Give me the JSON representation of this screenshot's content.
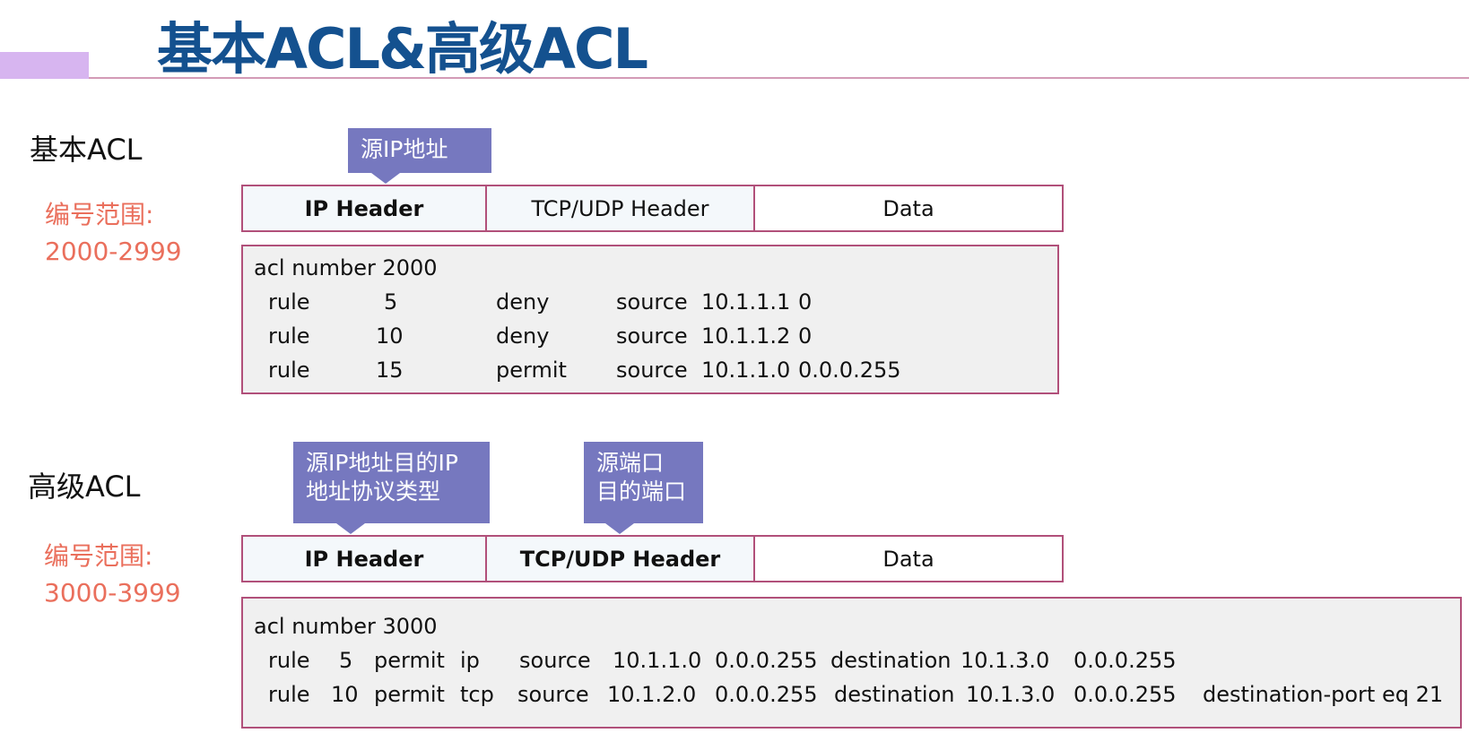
{
  "title": "基本ACL&高级ACL",
  "basic": {
    "section_title": "基本ACL",
    "range_label": "编号范围:",
    "range_value": "2000-2999",
    "callout": "源IP地址",
    "headers": [
      "IP Header",
      "TCP/UDP Header",
      "Data"
    ],
    "config_title": "acl number 2000",
    "rules": [
      [
        "rule",
        "5",
        "deny",
        "source",
        "10.1.1.1",
        "0"
      ],
      [
        "rule",
        "10",
        "deny",
        "source",
        "10.1.1.2",
        "0"
      ],
      [
        "rule",
        "15",
        "permit",
        "source",
        "10.1.1.0",
        "0.0.0.255"
      ]
    ]
  },
  "advanced": {
    "section_title": "高级ACL",
    "range_label": "编号范围:",
    "range_value": "3000-3999",
    "callout_ip_line1": "源IP地址目的IP",
    "callout_ip_line2": "地址协议类型",
    "callout_port_line1": "源端口",
    "callout_port_line2": "目的端口",
    "headers": [
      "IP Header",
      "TCP/UDP Header",
      "Data"
    ],
    "config_title": "acl number 3000",
    "rules": [
      [
        "rule",
        "5",
        "permit",
        "ip",
        "source",
        "10.1.1.0",
        "0.0.0.255",
        "destination",
        "10.1.3.0",
        "0.0.0.255",
        ""
      ],
      [
        "rule",
        "10",
        "permit",
        "tcp",
        "source",
        "10.1.2.0",
        "0.0.0.255",
        "destination",
        "10.1.3.0",
        "0.0.0.255",
        "destination-port eq 21"
      ]
    ]
  },
  "colors": {
    "title": "#14518f",
    "range": "#ea6f5c",
    "callout": "#7678bf",
    "border": "#b1507a"
  }
}
